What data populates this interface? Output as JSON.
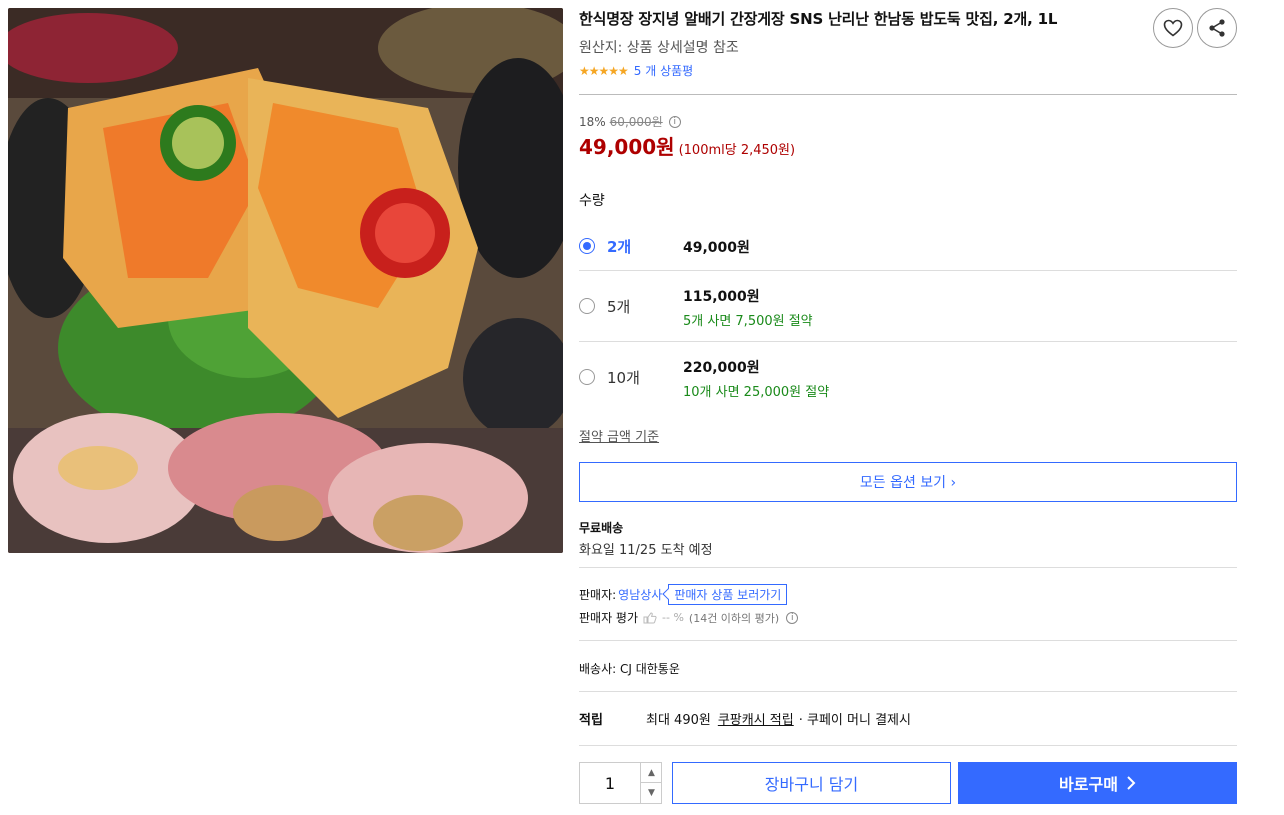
{
  "product": {
    "title": "한식명장 장지녕 알배기 간장게장 SNS 난리난 한남동 밥도둑 맛집, 2개, 1L",
    "origin": "원산지: 상품 상세설명 참조",
    "stars": "★★★★★",
    "rating_value": 5,
    "review_count_text": "5 개 상품평",
    "image_icon": "crab-dish-photo"
  },
  "price": {
    "discount_rate": "18%",
    "original_price": "60,000원",
    "sale_price": "49,000원",
    "unit_price": "(100ml당 2,450원)"
  },
  "quantity": {
    "label": "수량",
    "options": [
      {
        "count": "2개",
        "price": "49,000원",
        "savings": "",
        "selected": true
      },
      {
        "count": "5개",
        "price": "115,000원",
        "savings": "5개 사면 7,500원 절약",
        "selected": false
      },
      {
        "count": "10개",
        "price": "220,000원",
        "savings": "10개 사면 25,000원 절약",
        "selected": false
      }
    ],
    "savings_basis_link": "절약 금액 기준",
    "all_options_button": "모든 옵션 보기 ›"
  },
  "shipping": {
    "title": "무료배송",
    "arrival": "화요일 11/25 도착 예정"
  },
  "seller": {
    "label": "판매자:",
    "name": "영남상사",
    "store_link": "판매자 상품 보러가기",
    "rating_label": "판매자 평가",
    "rating_value": "-- %",
    "rating_note": "(14건 이하의 평가)"
  },
  "courier": {
    "text": "배송사:  CJ 대한통운"
  },
  "points": {
    "label": "적립",
    "max_text": "최대 490원",
    "cash_link": "쿠팡캐시 적립",
    "suffix": "· 쿠페이 머니 결제시"
  },
  "purchase": {
    "quantity_value": "1",
    "cart_button": "장바구니 담기",
    "buy_button": "바로구매"
  },
  "colors": {
    "accent": "#346aff",
    "price_red": "#ae0000",
    "savings_green": "#1a8a1a",
    "star": "#f5a623"
  }
}
